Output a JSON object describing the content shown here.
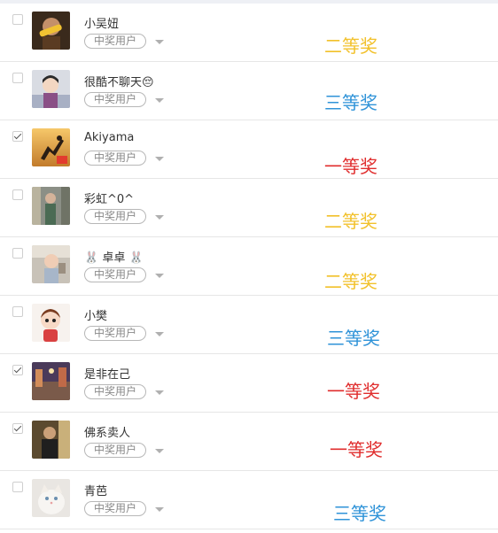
{
  "rows": [
    {
      "name": "小吴妞",
      "tag": "中奖用户",
      "prize": "二等奖",
      "prize_color": "#f2c12b",
      "checked": false,
      "avatar_icon": "corn-photo-avatar"
    },
    {
      "name": "很酷不聊天😔",
      "tag": "中奖用户",
      "prize": "三等奖",
      "prize_color": "#2f93d8",
      "checked": false,
      "avatar_icon": "cartoon-girl-avatar"
    },
    {
      "name": "Akiyama",
      "tag": "中奖用户",
      "prize": "一等奖",
      "prize_color": "#e02d2d",
      "checked": true,
      "avatar_icon": "silhouette-sunset-avatar"
    },
    {
      "name": "彩虹^0^",
      "tag": "中奖用户",
      "prize": "二等奖",
      "prize_color": "#f2c12b",
      "checked": false,
      "avatar_icon": "person-photo-avatar"
    },
    {
      "name": "🐰 卓卓 🐰",
      "tag": "中奖用户",
      "prize": "二等奖",
      "prize_color": "#f2c12b",
      "checked": false,
      "avatar_icon": "child-photo-avatar"
    },
    {
      "name": "小樊",
      "tag": "中奖用户",
      "prize": "三等奖",
      "prize_color": "#2f93d8",
      "checked": false,
      "avatar_icon": "cartoon-boy-avatar"
    },
    {
      "name": "是非在己",
      "tag": "中奖用户",
      "prize": "一等奖",
      "prize_color": "#e02d2d",
      "checked": true,
      "avatar_icon": "street-photo-avatar"
    },
    {
      "name": "佛系卖人",
      "tag": "中奖用户",
      "prize": "一等奖",
      "prize_color": "#e02d2d",
      "checked": true,
      "avatar_icon": "portrait-photo-avatar"
    },
    {
      "name": "青芭",
      "tag": "中奖用户",
      "prize": "三等奖",
      "prize_color": "#2f93d8",
      "checked": false,
      "avatar_icon": "cat-photo-avatar"
    }
  ]
}
